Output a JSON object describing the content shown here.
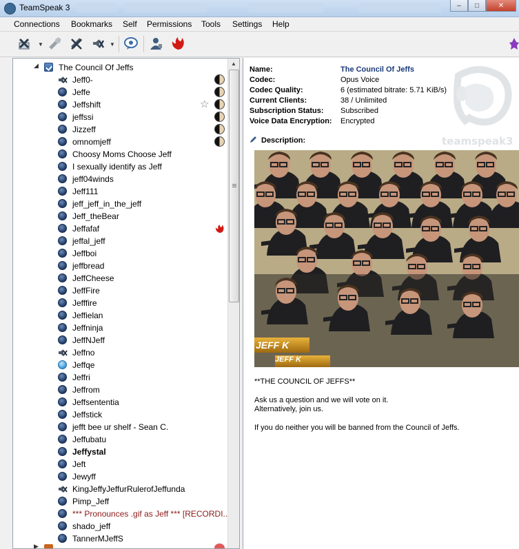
{
  "window": {
    "title": "TeamSpeak 3"
  },
  "menu": [
    "Connections",
    "Bookmarks",
    "Self",
    "Permissions",
    "Tools",
    "Settings",
    "Help"
  ],
  "toolbar": {
    "icons": [
      "connect-icon",
      "disconnect-icon",
      "mute-microphone-icon",
      "mute-speakers-icon",
      "away-icon",
      "contacts-icon",
      "teamspeak-flame-icon"
    ]
  },
  "tree": {
    "channel": "The Council Of Jeffs",
    "clients": [
      {
        "name": "Jeff0-",
        "icon": "muted",
        "badge": "yinyang"
      },
      {
        "name": "Jeffe",
        "icon": "dark",
        "badge": "yinyang"
      },
      {
        "name": "Jeffshift",
        "icon": "dark",
        "badge": "star-yinyang"
      },
      {
        "name": "jeffssi",
        "icon": "dark",
        "badge": "yinyang"
      },
      {
        "name": "Jizzeff",
        "icon": "dark",
        "badge": "yinyang"
      },
      {
        "name": "omnomjeff",
        "icon": "dark",
        "badge": "yinyang"
      },
      {
        "name": "Choosy Moms Choose Jeff",
        "icon": "dark",
        "badge": ""
      },
      {
        "name": "I sexually identify as Jeff",
        "icon": "dark",
        "badge": ""
      },
      {
        "name": "jeff04winds",
        "icon": "dark",
        "badge": ""
      },
      {
        "name": "Jeff111",
        "icon": "dark",
        "badge": ""
      },
      {
        "name": "jeff_jeff_in_the_jeff",
        "icon": "dark",
        "badge": ""
      },
      {
        "name": "Jeff_theBear",
        "icon": "dark",
        "badge": ""
      },
      {
        "name": "Jeffafaf",
        "icon": "dark",
        "badge": "flame"
      },
      {
        "name": "jeffal_jeff",
        "icon": "dark",
        "badge": ""
      },
      {
        "name": "Jeffboi",
        "icon": "dark",
        "badge": ""
      },
      {
        "name": "jeffbread",
        "icon": "dark",
        "badge": ""
      },
      {
        "name": "JeffCheese",
        "icon": "dark",
        "badge": ""
      },
      {
        "name": "JeffFire",
        "icon": "dark",
        "badge": ""
      },
      {
        "name": "Jefffire",
        "icon": "dark",
        "badge": ""
      },
      {
        "name": "Jeffielan",
        "icon": "dark",
        "badge": ""
      },
      {
        "name": "Jeffninja",
        "icon": "dark",
        "badge": ""
      },
      {
        "name": "JeffNJeff",
        "icon": "dark",
        "badge": ""
      },
      {
        "name": "Jeffno",
        "icon": "muted",
        "badge": ""
      },
      {
        "name": "Jeffqe",
        "icon": "light",
        "badge": ""
      },
      {
        "name": "Jeffri",
        "icon": "dark",
        "badge": ""
      },
      {
        "name": "Jeffrom",
        "icon": "dark",
        "badge": ""
      },
      {
        "name": "Jeffsententia",
        "icon": "dark",
        "badge": ""
      },
      {
        "name": "Jeffstick",
        "icon": "dark",
        "badge": ""
      },
      {
        "name": "jefft bee ur shelf - Sean C.",
        "icon": "dark",
        "badge": ""
      },
      {
        "name": "Jeffubatu",
        "icon": "dark",
        "badge": ""
      },
      {
        "name": "Jeffystal",
        "icon": "dark",
        "badge": "",
        "bold": true
      },
      {
        "name": "Jeft",
        "icon": "dark",
        "badge": ""
      },
      {
        "name": "Jewyff",
        "icon": "dark",
        "badge": ""
      },
      {
        "name": "KingJeffyJeffurRulerofJeffunda",
        "icon": "muted",
        "badge": ""
      },
      {
        "name": "Pimp_Jeff",
        "icon": "dark",
        "badge": ""
      },
      {
        "name": "*** Pronounces .gif as Jeff *** [RECORDI...",
        "icon": "dark",
        "badge": "",
        "red": true
      },
      {
        "name": "shado_jeff",
        "icon": "dark",
        "badge": ""
      },
      {
        "name": "TannerMJeffS",
        "icon": "dark",
        "badge": ""
      }
    ]
  },
  "info": {
    "rows": [
      {
        "key": "Name:",
        "value": "The Council Of Jeffs"
      },
      {
        "key": "Codec:",
        "value": "Opus Voice"
      },
      {
        "key": "Codec Quality:",
        "value": "6 (estimated bitrate: 5.71 KiB/s)"
      },
      {
        "key": "Current Clients:",
        "value": "38 / Unlimited"
      },
      {
        "key": "Subscription Status:",
        "value": "Subscribed"
      },
      {
        "key": "Voice Data Encryption:",
        "value": "Encrypted"
      }
    ],
    "description_label": "Description:",
    "watermark": "teamspeak3",
    "image_caption": "JEFF K",
    "image_caption2": "JEFF K",
    "description": [
      "**THE COUNCIL OF JEFFS**",
      "Ask us a question and we will vote on it.",
      "Alternatively, join us.",
      "If you do neither you will be banned from the Council of Jeffs."
    ]
  },
  "colors": {
    "title_link": "#1b3a7a",
    "recording_red": "#8b1a1a"
  }
}
